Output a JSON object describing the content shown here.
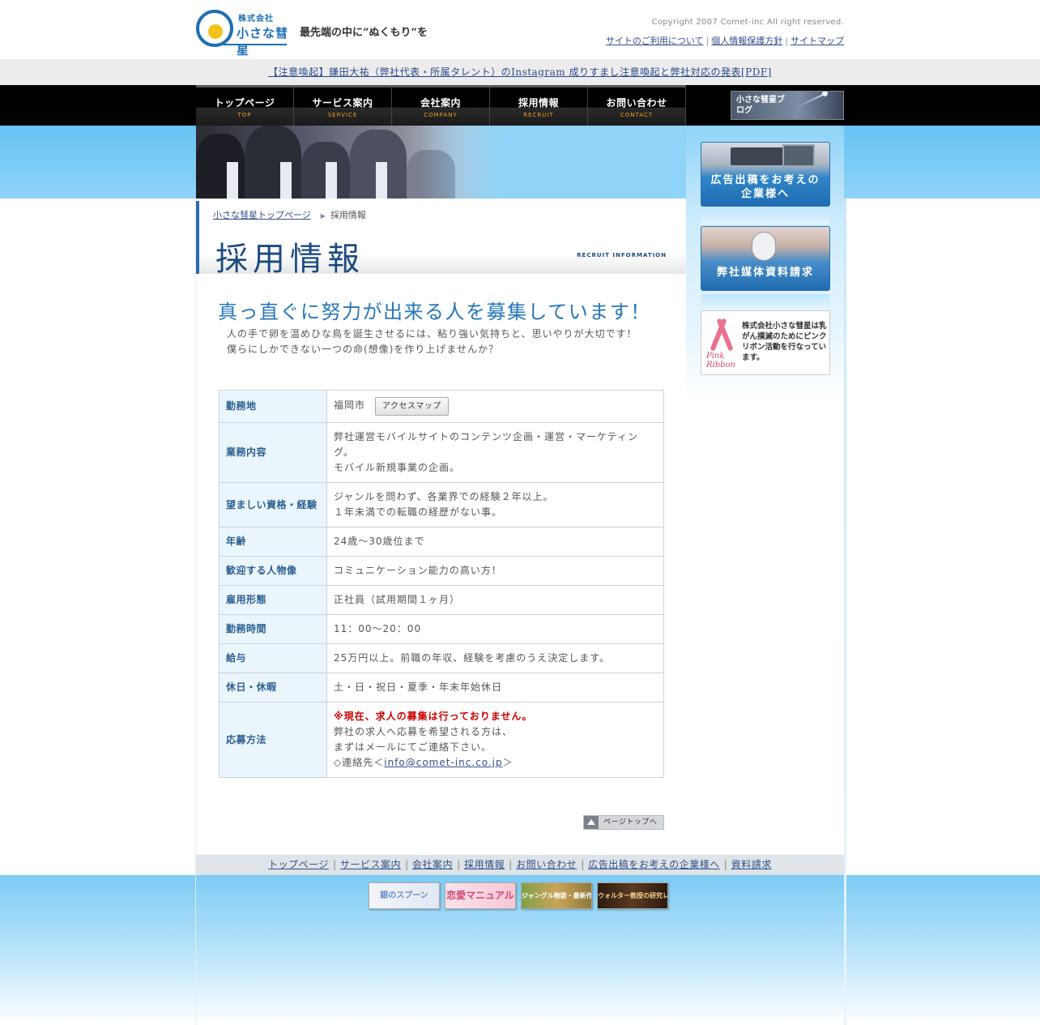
{
  "header": {
    "logo_small": "株式会社",
    "logo_name": "小さな彗星",
    "tagline": "最先端の中に”ぬくもり”を",
    "copyright": "Copyright  2007 Comet-inc All right reserved.",
    "links": [
      "サイトのご利用について",
      "個人情報保護方針",
      "サイトマップ"
    ]
  },
  "notice": {
    "text": "【注意喚起】鎌田大祐（弊社代表・所属タレント）のInstagram 成りすまし注意喚起と弊社対応の発表[PDF]"
  },
  "nav": {
    "items": [
      {
        "jp": "トップページ",
        "en": "TOP"
      },
      {
        "jp": "サービス案内",
        "en": "SERVICE"
      },
      {
        "jp": "会社案内",
        "en": "COMPANY"
      },
      {
        "jp": "採用情報",
        "en": "RECRUIT"
      },
      {
        "jp": "お問い合わせ",
        "en": "CONTACT"
      }
    ],
    "blog_label": "小さな彗星ブログ"
  },
  "breadcrumb": {
    "home": "小さな彗星トップページ",
    "current": "採用情報"
  },
  "page": {
    "title": "採用情報",
    "title_en": "RECRUIT INFORMATION",
    "headline": "真っ直ぐに努力が出来る人を募集しています！",
    "intro_line1": "人の手で卵を温めひな鳥を誕生させるには、粘り強い気持ちと、思いやりが大切です！",
    "intro_line2": "僕らにしかできない一つの命(想像)を作り上げませんか？"
  },
  "job": {
    "location_label": "勤務地",
    "location_value": "福岡市",
    "map_button": "アクセスマップ",
    "duties_label": "業務内容",
    "duties_line1": "弊社運営モバイルサイトのコンテンツ企画・運営・マーケティング。",
    "duties_line2": "モバイル新規事業の企画。",
    "qual_label": "望ましい資格・経験",
    "qual_line1": "ジャンルを問わず、各業界での経験２年以上。",
    "qual_line2": "１年未満での転職の経歴がない事。",
    "age_label": "年齢",
    "age_value": "24歳～30歳位まで",
    "person_label": "歓迎する人物像",
    "person_value": "コミュニケーション能力の高い方！",
    "employment_label": "雇用形態",
    "employment_value": "正社員（試用期間１ヶ月）",
    "hours_label": "勤務時間",
    "hours_value": "11：00～20：00",
    "salary_label": "給与",
    "salary_value": "25万円以上。前職の年収、経験を考慮のうえ決定します。",
    "holiday_label": "休日・休暇",
    "holiday_value": "土・日・祝日・夏季・年末年始休日",
    "apply_label": "応募方法",
    "apply_notice": "※現在、求人の募集は行っておりません。",
    "apply_line1": "弊社の求人へ応募を希望される方は、",
    "apply_line2": "まずはメールにてご連絡下さい。",
    "apply_prefix": "◇連絡先＜",
    "apply_email": "info@comet-inc.co.jp",
    "apply_suffix": "＞"
  },
  "pagetop": "ページトップへ",
  "sidebar": {
    "ad_line1": "広告出稿をお考えの",
    "ad_line2": "企業様へ",
    "doc_label": "弊社媒体資料請求",
    "ribbon_pink": "Pink",
    "ribbon_ribbon": "Ribbon",
    "ribbon_text": "株式会社小さな彗星は乳がん撲滅のためにピンクリボン活動を行なっています。"
  },
  "footer": {
    "links": [
      "トップページ",
      "サービス案内",
      "会社案内",
      "採用情報",
      "お問い合わせ",
      "広告出稿をお考えの企業様へ",
      "資料請求"
    ]
  },
  "banners": [
    "銀のスプーン",
    "恋愛マニュアル",
    "ジャングル物語・最新作",
    "ウォルター教授の研究レポート"
  ],
  "colors": {
    "brand_blue": "#1e6fb5",
    "headline_blue": "#2577b8",
    "sky": "#8fd3f8",
    "nav_accent": "#f0a020",
    "alert_red": "#cc0000"
  }
}
